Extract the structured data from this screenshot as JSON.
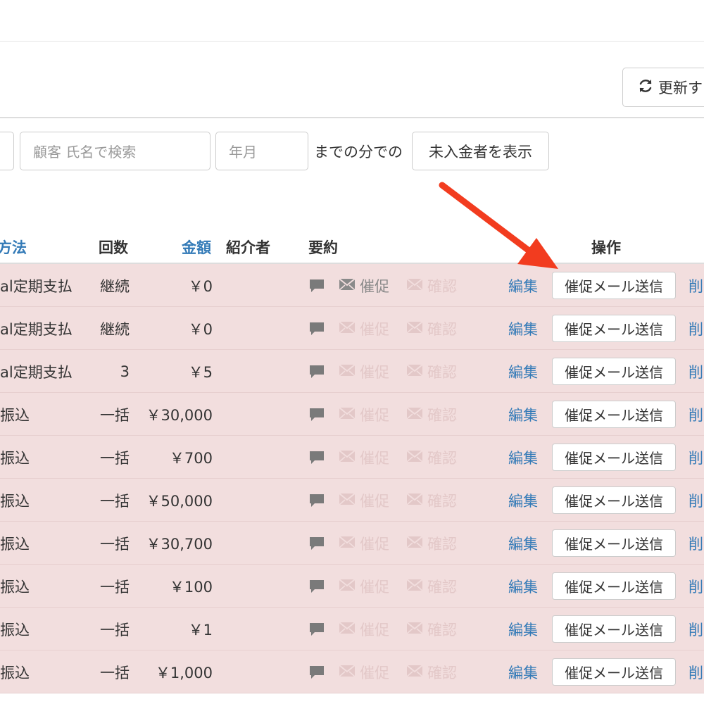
{
  "toolbar": {
    "refresh_label": "更新す"
  },
  "filters": {
    "name_placeholder": "顧客 氏名で検索",
    "month_placeholder": "年月",
    "until_label": "までの分での",
    "show_unpaid_label": "未入金者を表示"
  },
  "table": {
    "headers": {
      "method": "方法",
      "count": "回数",
      "amount": "金額",
      "introducer": "紹介者",
      "summary": "要約",
      "operations": "操作"
    },
    "action_labels": {
      "remind": "催促",
      "confirm": "確認",
      "edit": "編集",
      "send_reminder": "催促メール送信",
      "delete": "削"
    },
    "rows": [
      {
        "method": "al定期支払",
        "count": "継続",
        "amount": "￥0",
        "remind_active": true
      },
      {
        "method": "al定期支払",
        "count": "継続",
        "amount": "￥0",
        "remind_active": false
      },
      {
        "method": "al定期支払",
        "count": "3",
        "amount": "￥5",
        "remind_active": false
      },
      {
        "method": "振込",
        "count": "一括",
        "amount": "￥30,000",
        "remind_active": false
      },
      {
        "method": "振込",
        "count": "一括",
        "amount": "￥700",
        "remind_active": false
      },
      {
        "method": "振込",
        "count": "一括",
        "amount": "￥50,000",
        "remind_active": false
      },
      {
        "method": "振込",
        "count": "一括",
        "amount": "￥30,700",
        "remind_active": false
      },
      {
        "method": "振込",
        "count": "一括",
        "amount": "￥100",
        "remind_active": false
      },
      {
        "method": "振込",
        "count": "一括",
        "amount": "￥1",
        "remind_active": false
      },
      {
        "method": "振込",
        "count": "一括",
        "amount": "￥1,000",
        "remind_active": false
      }
    ]
  },
  "annotation": {
    "arrow_color": "#f23c1f"
  },
  "colors": {
    "row_highlight": "#f2dede",
    "link": "#337ab7",
    "disabled_text": "#e3c8c8"
  },
  "icons": {
    "refresh": "refresh-icon",
    "comment": "comment-icon",
    "mail": "envelope-icon"
  }
}
